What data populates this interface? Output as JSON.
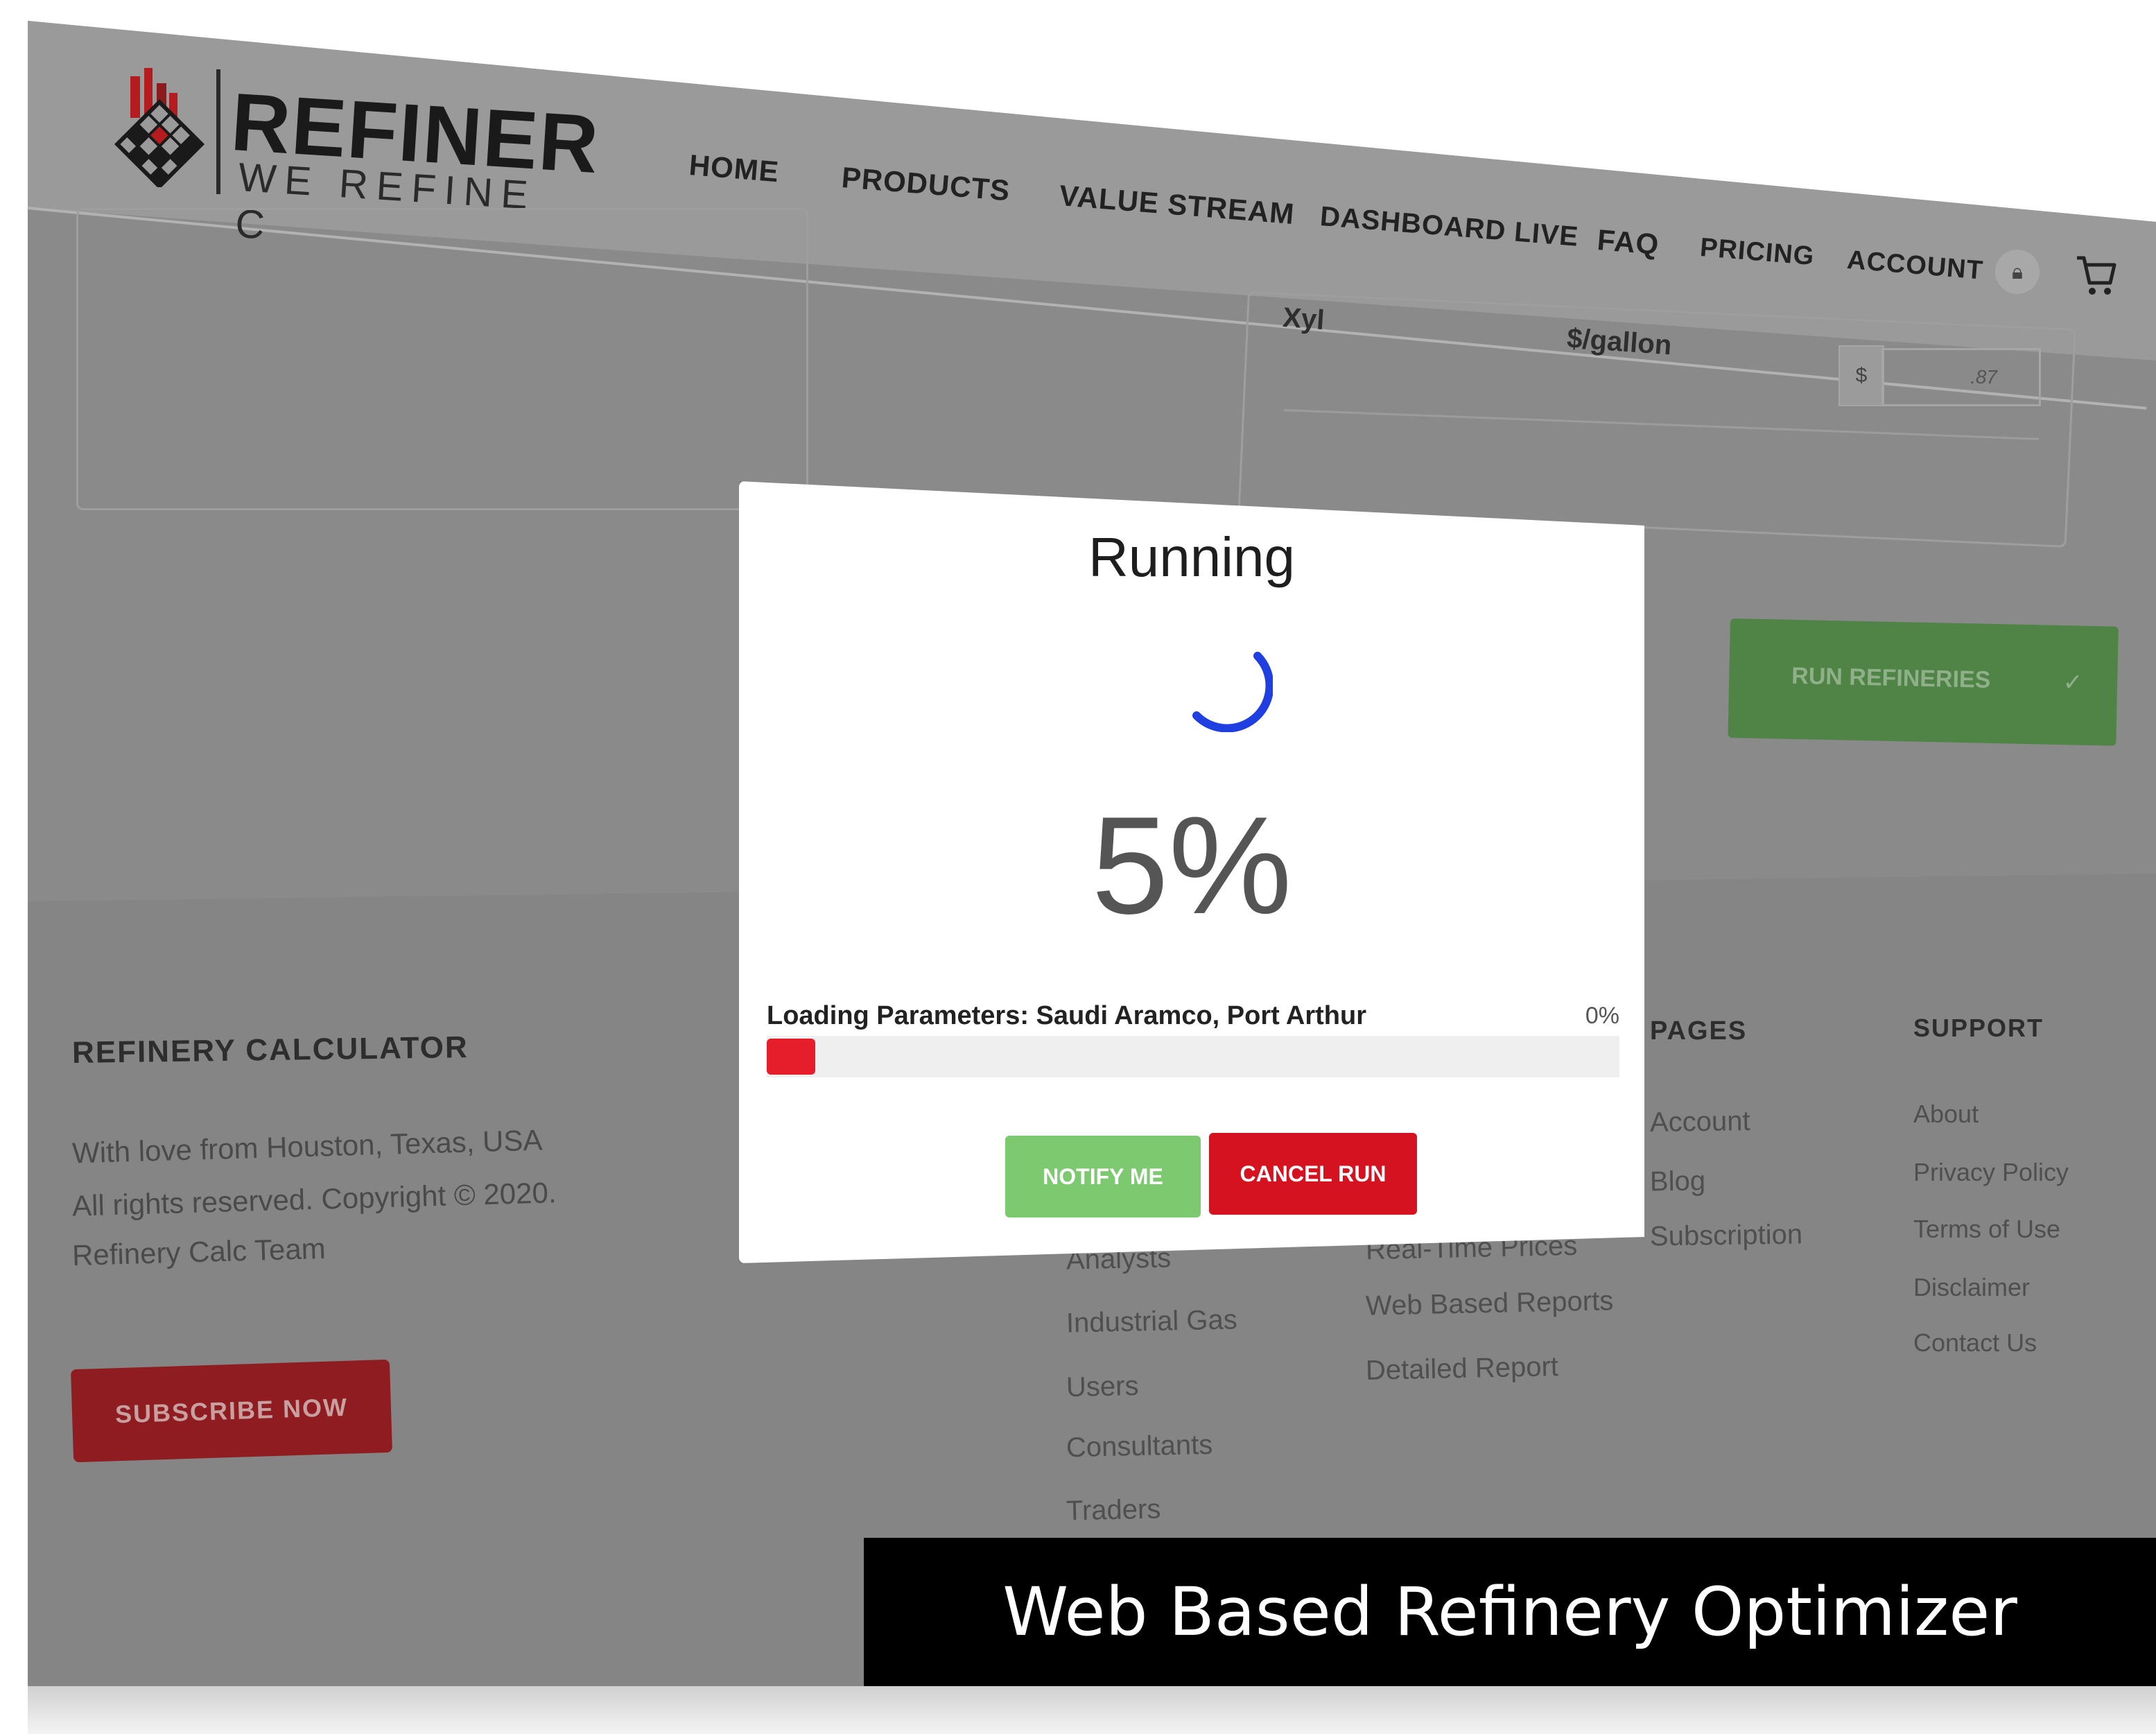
{
  "logo": {
    "title": "REFINER",
    "subtitle": "WE REFINE C",
    "icon": "refinery-logo-icon"
  },
  "nav": {
    "items": [
      "HOME",
      "PRODUCTS",
      "VALUE STREAM",
      "DASHBOARD LIVE",
      "FAQ",
      "PRICING",
      "ACCOUNT"
    ],
    "lock_icon": "lock-icon",
    "cart_icon": "cart-icon"
  },
  "param_row": {
    "name": "Xyl",
    "unit": "$/gallon",
    "currency": "$",
    "value": ".87"
  },
  "run_button": {
    "label": "RUN REFINERIES",
    "check": "✓"
  },
  "modal": {
    "title": "Running",
    "percent": "5%",
    "percent_value": 5,
    "loading_label": "Loading Parameters: Saudi Aramco, Port Arthur",
    "loading_percent": "0%",
    "notify_label": "NOTIFY ME",
    "cancel_label": "CANCEL RUN",
    "colors": {
      "spinner": "#1f3fe0",
      "progress": "#e61e2b",
      "notify": "#7cc970",
      "cancel": "#d5121f"
    }
  },
  "footer": {
    "about": {
      "heading": "REFINERY CALCULATOR",
      "lines": [
        "With love from Houston, Texas, USA",
        "All rights reserved. Copyright © 2020.",
        "Refinery Calc Team"
      ],
      "subscribe_label": "SUBSCRIBE NOW"
    },
    "col1": {
      "items": [
        "Analysts",
        "Industrial Gas",
        "Users",
        "Consultants",
        "Traders"
      ]
    },
    "col2": {
      "items": [
        "Real-Time Prices",
        "Web Based Reports",
        "Detailed Report"
      ]
    },
    "pages": {
      "heading": "PAGES",
      "items": [
        "Account",
        "Blog",
        "Subscription"
      ]
    },
    "support": {
      "heading": "SUPPORT",
      "items": [
        "About",
        "Privacy Policy",
        "Terms of Use",
        "Disclaimer",
        "Contact Us"
      ]
    }
  },
  "caption": "Web Based Refinery Optimizer"
}
